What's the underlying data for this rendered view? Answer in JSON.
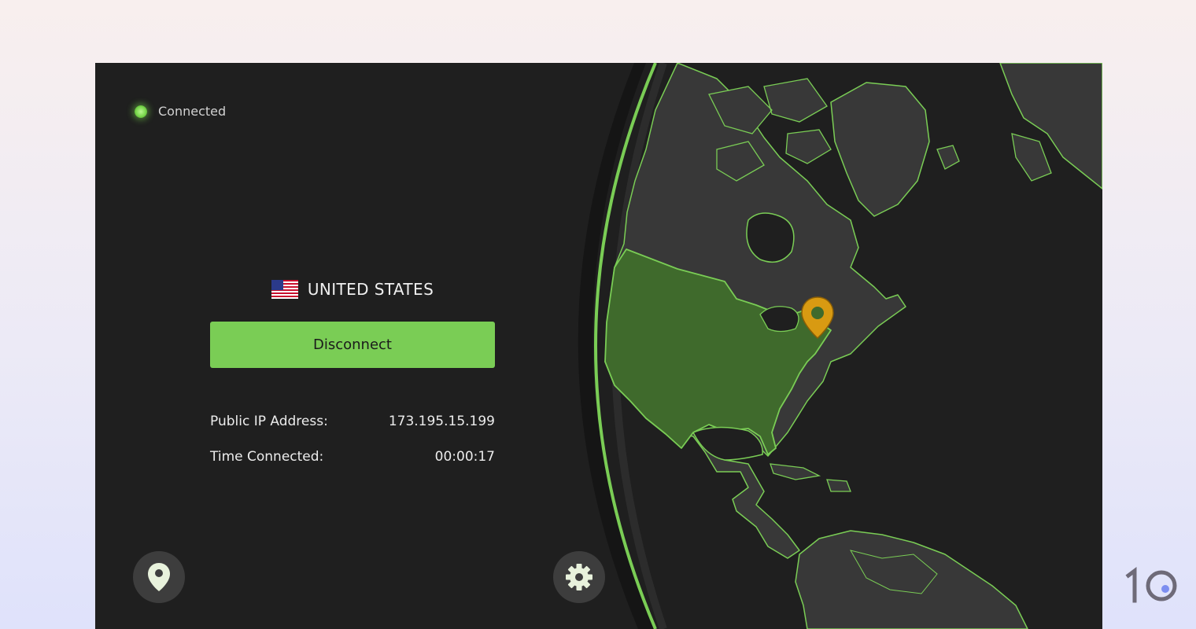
{
  "status": {
    "label": "Connected",
    "icon": "status-dot-icon",
    "color": "#7acd55"
  },
  "location": {
    "country": "UNITED STATES",
    "flag_icon": "us-flag-icon"
  },
  "actions": {
    "disconnect_label": "Disconnect"
  },
  "connection_info": {
    "ip_label": "Public IP Address:",
    "ip_value": "173.195.15.199",
    "time_label": "Time Connected:",
    "time_value": "00:00:17"
  },
  "bottom_bar": {
    "locations_icon": "map-pin-icon",
    "settings_icon": "gear-icon"
  },
  "map": {
    "highlight_color": "#3f6a2c",
    "outline_color": "#7acd55",
    "pin_color": "#d89a12"
  },
  "brand_badge": {
    "icon": "brand-10-logo"
  }
}
